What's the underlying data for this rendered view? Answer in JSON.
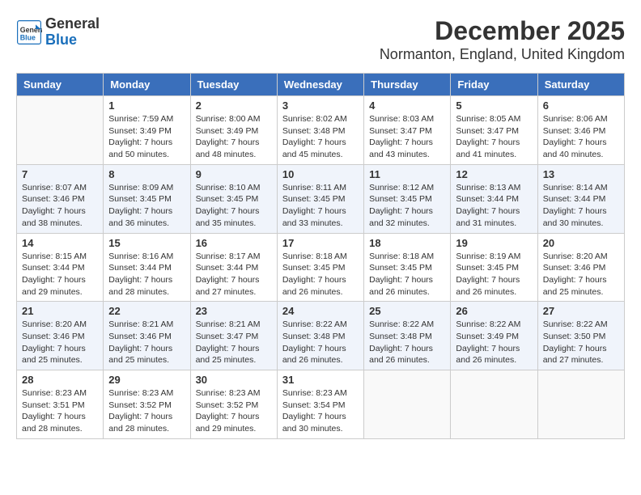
{
  "logo": {
    "general": "General",
    "blue": "Blue"
  },
  "title": "December 2025",
  "subtitle": "Normanton, England, United Kingdom",
  "weekdays": [
    "Sunday",
    "Monday",
    "Tuesday",
    "Wednesday",
    "Thursday",
    "Friday",
    "Saturday"
  ],
  "weeks": [
    [
      {
        "day": "",
        "info": ""
      },
      {
        "day": "1",
        "info": "Sunrise: 7:59 AM\nSunset: 3:49 PM\nDaylight: 7 hours\nand 50 minutes."
      },
      {
        "day": "2",
        "info": "Sunrise: 8:00 AM\nSunset: 3:49 PM\nDaylight: 7 hours\nand 48 minutes."
      },
      {
        "day": "3",
        "info": "Sunrise: 8:02 AM\nSunset: 3:48 PM\nDaylight: 7 hours\nand 45 minutes."
      },
      {
        "day": "4",
        "info": "Sunrise: 8:03 AM\nSunset: 3:47 PM\nDaylight: 7 hours\nand 43 minutes."
      },
      {
        "day": "5",
        "info": "Sunrise: 8:05 AM\nSunset: 3:47 PM\nDaylight: 7 hours\nand 41 minutes."
      },
      {
        "day": "6",
        "info": "Sunrise: 8:06 AM\nSunset: 3:46 PM\nDaylight: 7 hours\nand 40 minutes."
      }
    ],
    [
      {
        "day": "7",
        "info": "Sunrise: 8:07 AM\nSunset: 3:46 PM\nDaylight: 7 hours\nand 38 minutes."
      },
      {
        "day": "8",
        "info": "Sunrise: 8:09 AM\nSunset: 3:45 PM\nDaylight: 7 hours\nand 36 minutes."
      },
      {
        "day": "9",
        "info": "Sunrise: 8:10 AM\nSunset: 3:45 PM\nDaylight: 7 hours\nand 35 minutes."
      },
      {
        "day": "10",
        "info": "Sunrise: 8:11 AM\nSunset: 3:45 PM\nDaylight: 7 hours\nand 33 minutes."
      },
      {
        "day": "11",
        "info": "Sunrise: 8:12 AM\nSunset: 3:45 PM\nDaylight: 7 hours\nand 32 minutes."
      },
      {
        "day": "12",
        "info": "Sunrise: 8:13 AM\nSunset: 3:44 PM\nDaylight: 7 hours\nand 31 minutes."
      },
      {
        "day": "13",
        "info": "Sunrise: 8:14 AM\nSunset: 3:44 PM\nDaylight: 7 hours\nand 30 minutes."
      }
    ],
    [
      {
        "day": "14",
        "info": "Sunrise: 8:15 AM\nSunset: 3:44 PM\nDaylight: 7 hours\nand 29 minutes."
      },
      {
        "day": "15",
        "info": "Sunrise: 8:16 AM\nSunset: 3:44 PM\nDaylight: 7 hours\nand 28 minutes."
      },
      {
        "day": "16",
        "info": "Sunrise: 8:17 AM\nSunset: 3:44 PM\nDaylight: 7 hours\nand 27 minutes."
      },
      {
        "day": "17",
        "info": "Sunrise: 8:18 AM\nSunset: 3:45 PM\nDaylight: 7 hours\nand 26 minutes."
      },
      {
        "day": "18",
        "info": "Sunrise: 8:18 AM\nSunset: 3:45 PM\nDaylight: 7 hours\nand 26 minutes."
      },
      {
        "day": "19",
        "info": "Sunrise: 8:19 AM\nSunset: 3:45 PM\nDaylight: 7 hours\nand 26 minutes."
      },
      {
        "day": "20",
        "info": "Sunrise: 8:20 AM\nSunset: 3:46 PM\nDaylight: 7 hours\nand 25 minutes."
      }
    ],
    [
      {
        "day": "21",
        "info": "Sunrise: 8:20 AM\nSunset: 3:46 PM\nDaylight: 7 hours\nand 25 minutes."
      },
      {
        "day": "22",
        "info": "Sunrise: 8:21 AM\nSunset: 3:46 PM\nDaylight: 7 hours\nand 25 minutes."
      },
      {
        "day": "23",
        "info": "Sunrise: 8:21 AM\nSunset: 3:47 PM\nDaylight: 7 hours\nand 25 minutes."
      },
      {
        "day": "24",
        "info": "Sunrise: 8:22 AM\nSunset: 3:48 PM\nDaylight: 7 hours\nand 26 minutes."
      },
      {
        "day": "25",
        "info": "Sunrise: 8:22 AM\nSunset: 3:48 PM\nDaylight: 7 hours\nand 26 minutes."
      },
      {
        "day": "26",
        "info": "Sunrise: 8:22 AM\nSunset: 3:49 PM\nDaylight: 7 hours\nand 26 minutes."
      },
      {
        "day": "27",
        "info": "Sunrise: 8:22 AM\nSunset: 3:50 PM\nDaylight: 7 hours\nand 27 minutes."
      }
    ],
    [
      {
        "day": "28",
        "info": "Sunrise: 8:23 AM\nSunset: 3:51 PM\nDaylight: 7 hours\nand 28 minutes."
      },
      {
        "day": "29",
        "info": "Sunrise: 8:23 AM\nSunset: 3:52 PM\nDaylight: 7 hours\nand 28 minutes."
      },
      {
        "day": "30",
        "info": "Sunrise: 8:23 AM\nSunset: 3:52 PM\nDaylight: 7 hours\nand 29 minutes."
      },
      {
        "day": "31",
        "info": "Sunrise: 8:23 AM\nSunset: 3:54 PM\nDaylight: 7 hours\nand 30 minutes."
      },
      {
        "day": "",
        "info": ""
      },
      {
        "day": "",
        "info": ""
      },
      {
        "day": "",
        "info": ""
      }
    ]
  ]
}
